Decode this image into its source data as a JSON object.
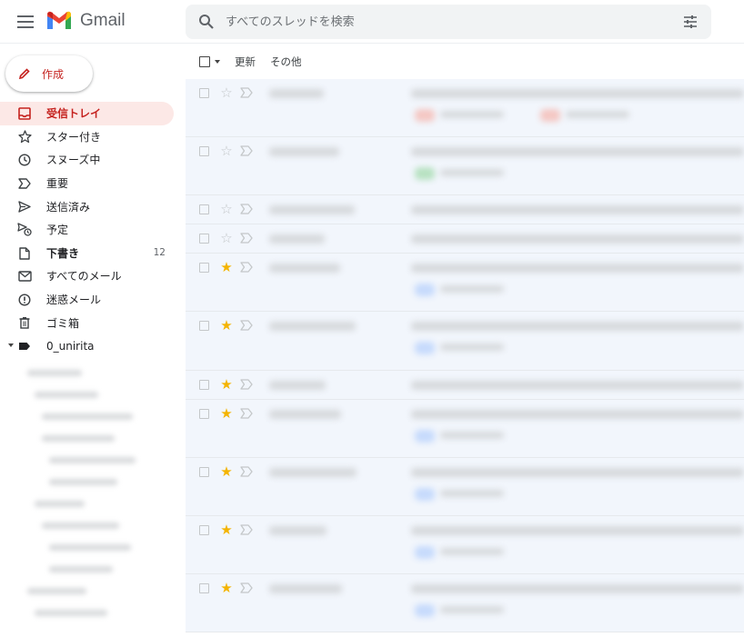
{
  "header": {
    "app_name": "Gmail",
    "search_placeholder": "すべてのスレッドを検索"
  },
  "sidebar": {
    "compose_label": "作成",
    "items": [
      {
        "label": "受信トレイ",
        "icon": "inbox-icon",
        "active": true
      },
      {
        "label": "スター付き",
        "icon": "star-icon"
      },
      {
        "label": "スヌーズ中",
        "icon": "clock-icon"
      },
      {
        "label": "重要",
        "icon": "important-icon"
      },
      {
        "label": "送信済み",
        "icon": "send-icon"
      },
      {
        "label": "予定",
        "icon": "scheduled-icon"
      },
      {
        "label": "下書き",
        "icon": "draft-icon",
        "count": "12"
      },
      {
        "label": "すべてのメール",
        "icon": "mail-icon"
      },
      {
        "label": "迷惑メール",
        "icon": "spam-icon"
      },
      {
        "label": "ゴミ箱",
        "icon": "trash-icon"
      },
      {
        "label": "0_unirita",
        "icon": "label-icon"
      }
    ]
  },
  "toolbar": {
    "refresh_label": "更新",
    "more_label": "その他"
  },
  "messages": [
    {
      "starred": false
    },
    {
      "starred": false
    },
    {
      "starred": false
    },
    {
      "starred": false
    },
    {
      "starred": true
    },
    {
      "starred": true
    },
    {
      "starred": true
    },
    {
      "starred": true
    },
    {
      "starred": true
    },
    {
      "starred": true
    },
    {
      "starred": true
    }
  ],
  "colors": {
    "active_bg": "#fce8e6",
    "active_text": "#c5221f",
    "star_filled": "#f4b400",
    "row_bg": "#f2f6fc"
  }
}
